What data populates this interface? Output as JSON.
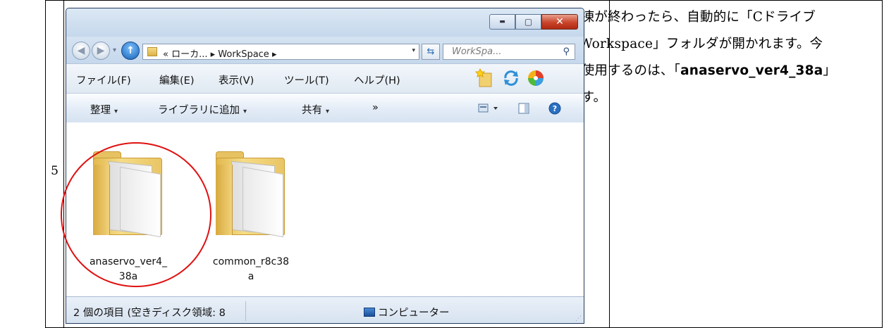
{
  "step": {
    "number": "5"
  },
  "description": {
    "before": "解凍が終わったら、自動的に「Cドライブ→Workspace」フォルダが開かれます。今回使用するのは、「",
    "bold": "anaservo_ver4_38a",
    "after": "」です。"
  },
  "window": {
    "caption_buttons": {
      "minimize": "▬",
      "maximize": "▢",
      "close": "✕"
    },
    "address": {
      "path": "« ローカ... ▸ WorkSpace ▸",
      "dropdown": "▾"
    },
    "refresh": "⇆",
    "search": {
      "placeholder": "WorkSpa...",
      "icon": "⚲"
    },
    "menu": [
      "ファイル(F)",
      "編集(E)",
      "表示(V)",
      "ツール(T)",
      "ヘルプ(H)"
    ],
    "commands": {
      "organize": "整理",
      "add_to_library": "ライブラリに追加",
      "share": "共有",
      "more": "»",
      "caret": "▾"
    },
    "items": [
      {
        "name_line1": "anaservo_ver4_",
        "name_line2": "38a"
      },
      {
        "name_line1": "common_r8c38",
        "name_line2": "a"
      }
    ],
    "status": {
      "count": "2 個の項目 (空きディスク領域: 8",
      "location": "コンピューター"
    }
  },
  "colors": {
    "annotation": "#e01010",
    "folder": "#f2d27a"
  }
}
